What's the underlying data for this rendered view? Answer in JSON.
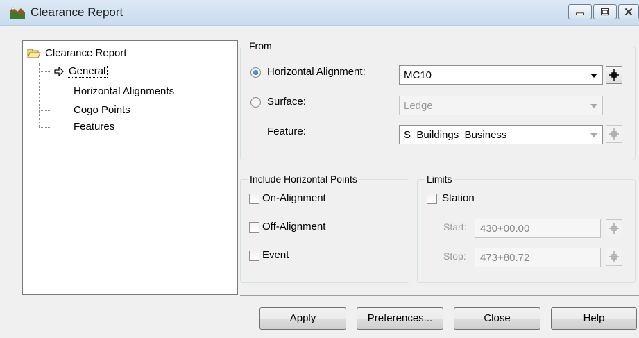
{
  "window": {
    "title": "Clearance Report"
  },
  "caption_buttons": {
    "minimize": "minimize-icon",
    "maximize": "maximize-icon",
    "close": "close-icon"
  },
  "tree": {
    "root": "Clearance Report",
    "items": [
      {
        "label": "General",
        "selected": true
      },
      {
        "label": "Horizontal Alignments"
      },
      {
        "label": "Cogo Points"
      },
      {
        "label": "Features"
      }
    ]
  },
  "from": {
    "group_label": "From",
    "horizontal_alignment_label": "Horizontal Alignment:",
    "horizontal_alignment_value": "MC10",
    "surface_label": "Surface:",
    "surface_value": "Ledge",
    "feature_label": "Feature:",
    "feature_value": "S_Buildings_Business",
    "selected_option": "Horizontal Alignment"
  },
  "include": {
    "group_label": "Include Horizontal Points",
    "on_alignment": "On-Alignment",
    "off_alignment": "Off-Alignment",
    "event": "Event"
  },
  "limits": {
    "group_label": "Limits",
    "station_label": "Station",
    "start_label": "Start:",
    "start_value": "430+00.00",
    "stop_label": "Stop:",
    "stop_value": "473+80.72"
  },
  "buttons": {
    "apply": "Apply",
    "preferences": "Preferences...",
    "close": "Close",
    "help": "Help"
  },
  "colors": {
    "titlebar": "#c9dcf0",
    "radio_selected": "#1a5fb8"
  }
}
